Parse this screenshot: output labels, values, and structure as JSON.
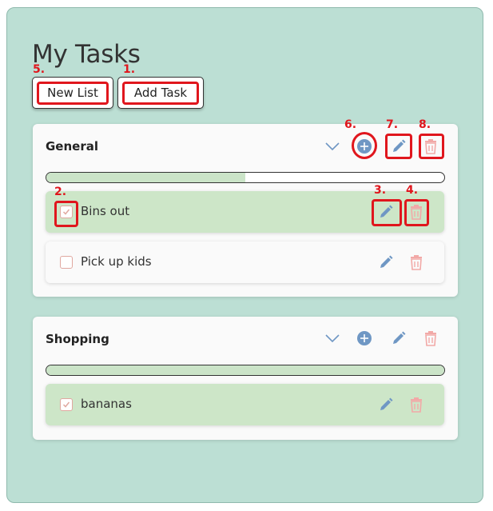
{
  "page": {
    "title": "My Tasks"
  },
  "toolbar": {
    "new_list_label": "New List",
    "add_task_label": "Add Task"
  },
  "colors": {
    "background": "#bcdfd4",
    "card": "#fafafa",
    "done_task": "#cde6c8",
    "progress_fill": "#cbe4c8",
    "edit_icon": "#6f97c4",
    "delete_icon": "#f2a9a7",
    "add_icon": "#6f97c4",
    "annotation": "#e0161d"
  },
  "lists": [
    {
      "title": "General",
      "progress_fraction": 0.5,
      "header_icons": [
        "chevron-down-icon",
        "add-circle-icon",
        "pencil-icon",
        "trash-icon"
      ],
      "tasks": [
        {
          "label": "Bins out",
          "done": true
        },
        {
          "label": "Pick up kids",
          "done": false
        }
      ]
    },
    {
      "title": "Shopping",
      "progress_fraction": 1.0,
      "header_icons": [
        "chevron-down-icon",
        "add-circle-icon",
        "pencil-icon",
        "trash-icon"
      ],
      "tasks": [
        {
          "label": "bananas",
          "done": true
        }
      ]
    }
  ],
  "annotations": [
    "5.",
    "1.",
    "6.",
    "7.",
    "8.",
    "2.",
    "3.",
    "4."
  ]
}
